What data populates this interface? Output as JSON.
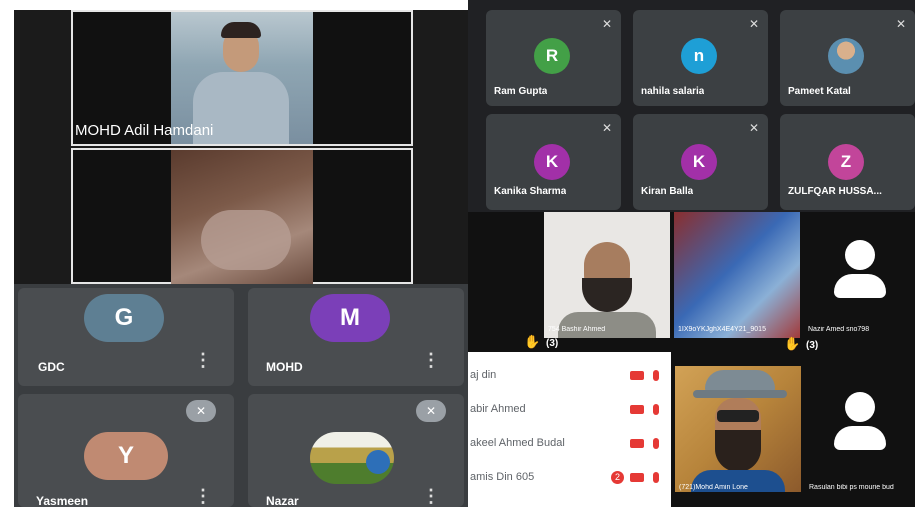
{
  "left_top": {
    "tile1_name": "MOHD Adil Hamdani"
  },
  "grid_top_right": {
    "tiles": [
      {
        "initial": "R",
        "name": "Ram Gupta",
        "color": "#43a047"
      },
      {
        "initial": "n",
        "name": "nahila salaria",
        "color": "#1e9fd6"
      },
      {
        "initial": "",
        "name": "Pameet Katal",
        "color": "#9e9e9e"
      },
      {
        "initial": "K",
        "name": "Kanika Sharma",
        "color": "#a230a8"
      },
      {
        "initial": "K",
        "name": "Kiran Balla",
        "color": "#a230a8"
      },
      {
        "initial": "Z",
        "name": "ZULFQAR HUSSA...",
        "color": "#c2459a"
      }
    ]
  },
  "grid_bottom_left": {
    "tiles": [
      {
        "initial": "G",
        "name": "GDC",
        "color": "#5e7f93"
      },
      {
        "initial": "M",
        "name": "MOHD",
        "color": "#7b3fb8"
      },
      {
        "initial": "Y",
        "name": "Yasmeen",
        "color": "#c08a72"
      },
      {
        "initial": "",
        "name": "Nazar",
        "color": "#6f8f3a"
      }
    ]
  },
  "middle_right": {
    "hand_count": "(3)",
    "tile1_name": "754 Bashir Ahmed",
    "tile2_name": "1IX9oYKJghX4E4Y21_9015",
    "tile2_hand_count": "(3)",
    "tile3_name": "Nazir Amed sno798",
    "tile4_name": "(721)Mohd Amin Lone",
    "tile5_name": "Rasulan bibi ps mourie bud"
  },
  "participants_list": {
    "rows": [
      {
        "name": "aj din",
        "badge": ""
      },
      {
        "name": "abir Ahmed",
        "badge": ""
      },
      {
        "name": "akeel Ahmed Budal",
        "badge": ""
      },
      {
        "name": "amis Din 605",
        "badge": "2"
      }
    ]
  }
}
